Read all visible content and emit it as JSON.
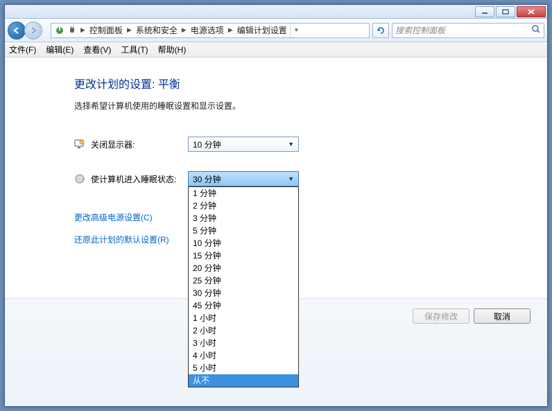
{
  "titlebar": {
    "min_icon": "minimize-icon",
    "max_icon": "maximize-icon",
    "close_icon": "close-icon"
  },
  "nav": {
    "breadcrumb": [
      "控制面板",
      "系统和安全",
      "电源选项",
      "编辑计划设置"
    ],
    "search_placeholder": "搜索控制面板"
  },
  "menubar": {
    "items": [
      "文件(F)",
      "编辑(E)",
      "查看(V)",
      "工具(T)",
      "帮助(H)"
    ]
  },
  "page": {
    "title": "更改计划的设置: 平衡",
    "subtitle": "选择希望计算机使用的睡眠设置和显示设置。",
    "display_off_label": "关闭显示器:",
    "display_off_value": "10 分钟",
    "sleep_label": "使计算机进入睡眠状态:",
    "sleep_value": "30 分钟",
    "sleep_options": [
      "1 分钟",
      "2 分钟",
      "3 分钟",
      "5 分钟",
      "10 分钟",
      "15 分钟",
      "20 分钟",
      "25 分钟",
      "30 分钟",
      "45 分钟",
      "1 小时",
      "2 小时",
      "3 小时",
      "4 小时",
      "5 小时",
      "从不"
    ],
    "sleep_highlighted": "从不",
    "link_advanced": "更改高级电源设置(C)",
    "link_restore": "还原此计划的默认设置(R)"
  },
  "footer": {
    "save_label": "保存修改",
    "cancel_label": "取消"
  },
  "colors": {
    "title": "#003399",
    "link": "#0066cc",
    "highlight": "#3d91df"
  }
}
